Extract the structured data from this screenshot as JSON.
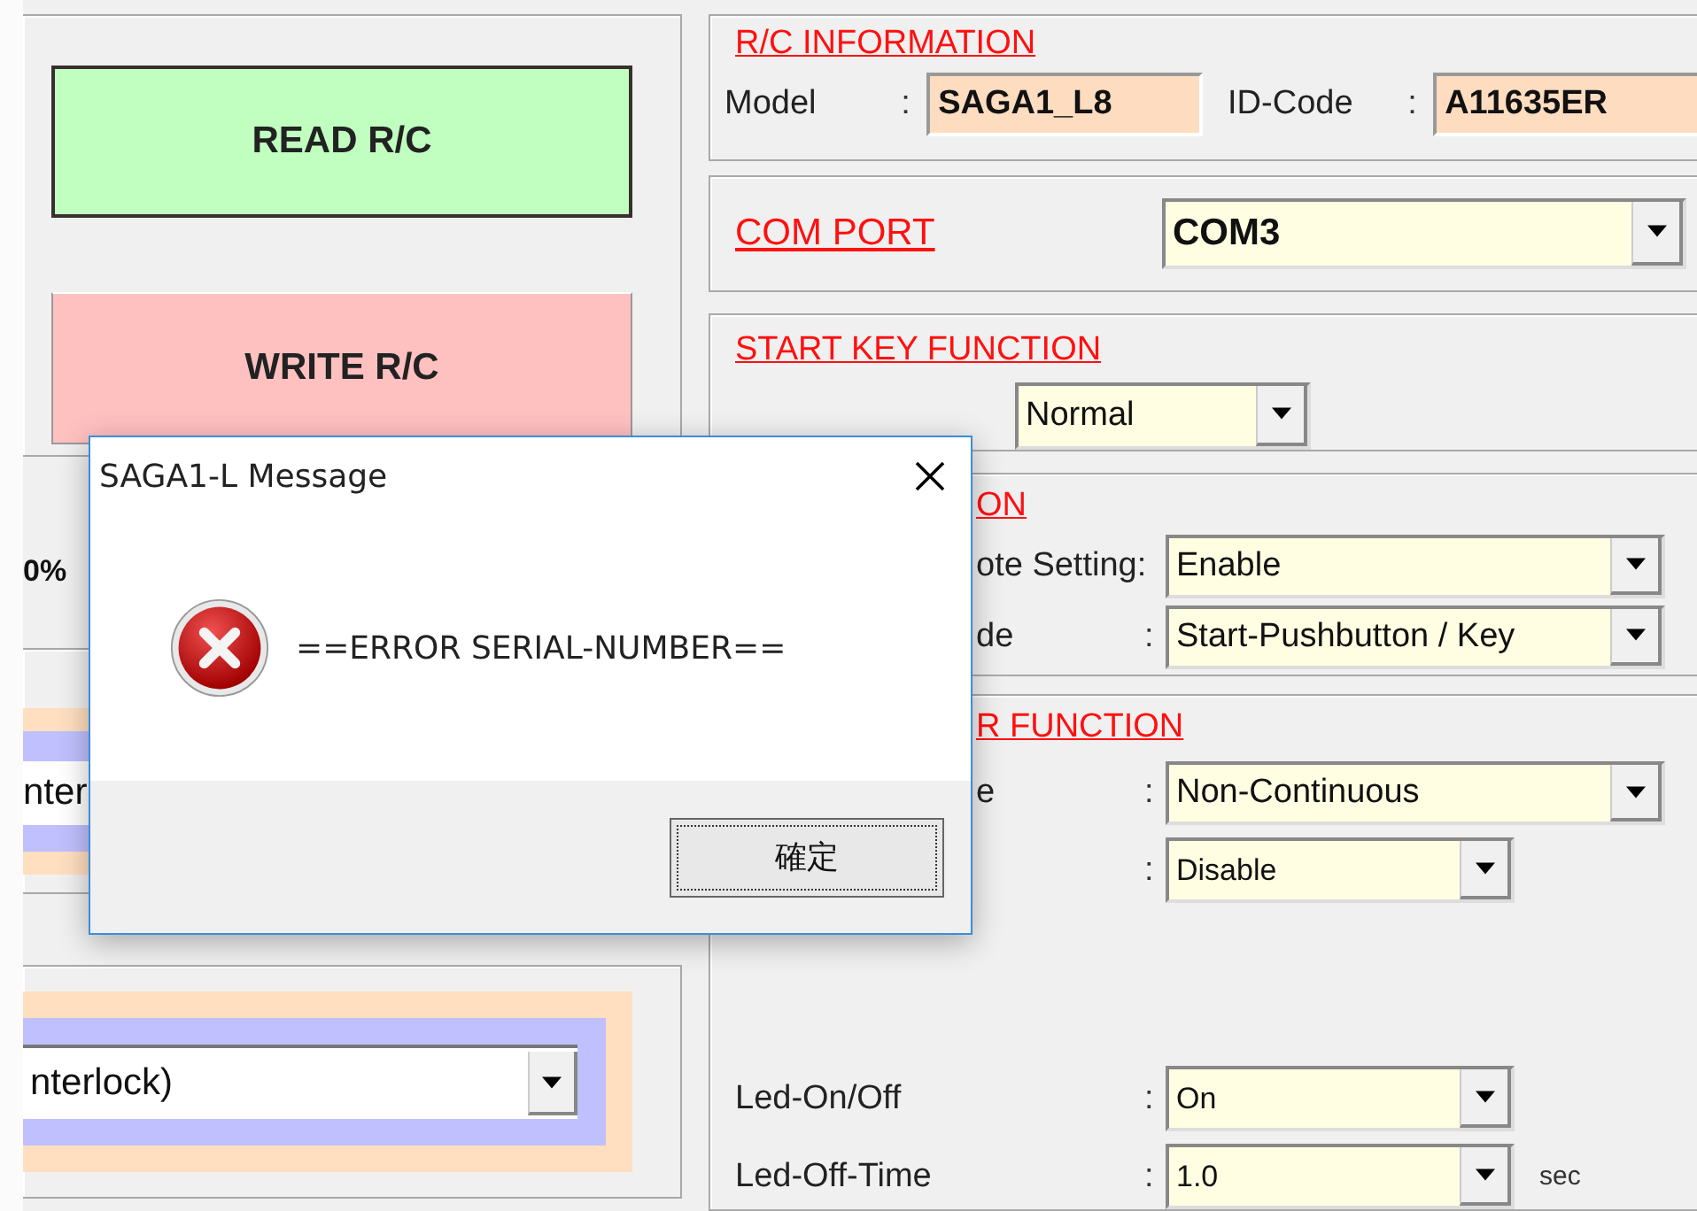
{
  "left_panel": {
    "buttons": [
      {
        "label": "READ  R/C",
        "kind": "read"
      },
      {
        "label": "WRITE R/C",
        "kind": "write"
      }
    ],
    "progress_text": "0%",
    "mode_select": {
      "value": "nter"
    },
    "interlock_select": {
      "value": "nterlock)"
    }
  },
  "rc_information": {
    "title": "R/C INFORMATION",
    "fields": [
      {
        "label": "Model",
        "separator": ":",
        "value": "SAGA1_L8"
      },
      {
        "label": "ID-Code",
        "separator": ":",
        "value": "A11635ER"
      }
    ]
  },
  "com_port": {
    "title": "COM  PORT",
    "value": "COM3"
  },
  "start_key_function": {
    "title": "START KEY FUNCTION",
    "value": "Normal"
  },
  "section_4": {
    "title": "ON",
    "rows": [
      {
        "label": "ote Setting:",
        "value": "Enable",
        "kind": "long"
      },
      {
        "label": "de",
        "separator": ":",
        "value": "Start-Pushbutton / Key",
        "kind": "long"
      }
    ]
  },
  "section_5": {
    "title": "R FUNCTION",
    "rows": [
      {
        "label": "e",
        "separator": ":",
        "value": "Non-Continuous",
        "kind": "long"
      },
      {
        "separator": ":",
        "value": "Disable",
        "kind": "short"
      },
      {
        "label": "Led-On/Off",
        "separator": ":",
        "value": "On",
        "kind": "short"
      },
      {
        "label": "Led-Off-Time",
        "separator": ":",
        "value": "1.0",
        "kind": "short",
        "unit": "sec"
      }
    ]
  },
  "dialog": {
    "title": "SAGA1-L Message",
    "message": "==ERROR SERIAL-NUMBER==",
    "button": "確定"
  }
}
